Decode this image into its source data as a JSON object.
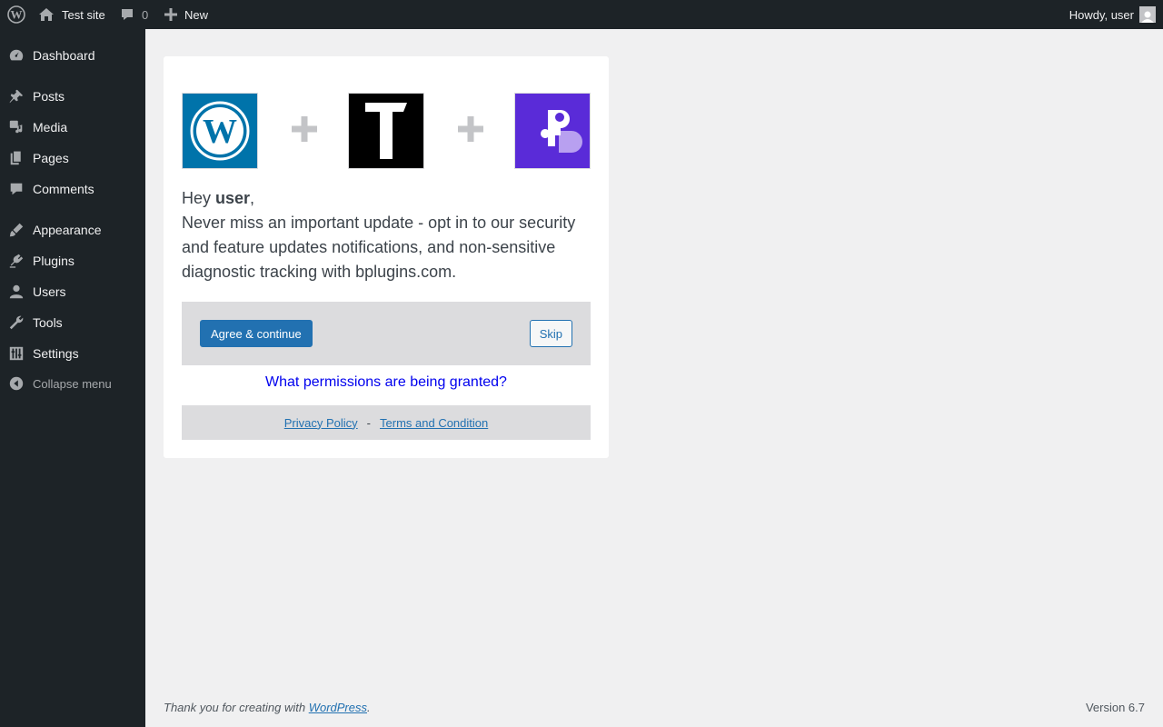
{
  "adminbar": {
    "site_name": "Test site",
    "comments_count": "0",
    "new_label": "New",
    "howdy": "Howdy, user"
  },
  "sidebar": {
    "items": [
      {
        "label": "Dashboard",
        "icon": "dashboard-icon"
      },
      {
        "label": "Posts",
        "icon": "pin-icon"
      },
      {
        "label": "Media",
        "icon": "media-icon"
      },
      {
        "label": "Pages",
        "icon": "pages-icon"
      },
      {
        "label": "Comments",
        "icon": "comment-icon"
      },
      {
        "label": "Appearance",
        "icon": "brush-icon"
      },
      {
        "label": "Plugins",
        "icon": "plugin-icon"
      },
      {
        "label": "Users",
        "icon": "user-icon"
      },
      {
        "label": "Tools",
        "icon": "wrench-icon"
      },
      {
        "label": "Settings",
        "icon": "settings-icon"
      }
    ],
    "collapse_label": "Collapse menu"
  },
  "optin": {
    "greeting": "Hey ",
    "username": "user",
    "greeting_end": ",",
    "message": "Never miss an important update - opt in to our security and feature updates notifications, and non-sensitive diagnostic tracking with bplugins.com.",
    "agree_label": "Agree & continue",
    "skip_label": "Skip",
    "permissions_link": "What permissions are being granted?",
    "privacy_label": "Privacy Policy",
    "separator": "-",
    "terms_label": "Terms and Condition"
  },
  "footer": {
    "thanks_prefix": "Thank you for creating with ",
    "thanks_link": "WordPress",
    "thanks_suffix": ".",
    "version": "Version 6.7"
  },
  "colors": {
    "adminbar_bg": "#1d2327",
    "accent": "#2271b1",
    "wp_logo_bg": "#0073aa",
    "plugin_logo_bg": "#5a2bd8"
  }
}
